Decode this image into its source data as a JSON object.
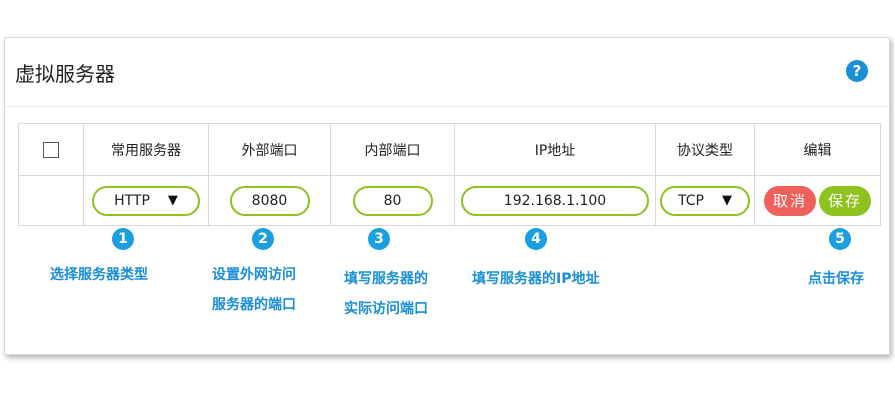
{
  "panel": {
    "title": "虚拟服务器"
  },
  "help_icon": "question-icon",
  "colors": {
    "accent_green": "#8dc21f",
    "cancel_red": "#f0615c",
    "callout_blue": "#1a9fe0",
    "help_blue": "#1a8ed6"
  },
  "table": {
    "headers": {
      "checkbox": "",
      "common_server": "常用服务器",
      "external_port": "外部端口",
      "internal_port": "内部端口",
      "ip_address": "IP地址",
      "protocol": "协议类型",
      "edit": "编辑"
    },
    "row": {
      "service": "HTTP",
      "external_port": "8080",
      "internal_port": "80",
      "ip_address": "192.168.1.100",
      "protocol": "TCP",
      "cancel_label": "取消",
      "save_label": "保存"
    }
  },
  "callouts": [
    {
      "num": "1",
      "lines": [
        "选择服务器类型"
      ]
    },
    {
      "num": "2",
      "lines": [
        "设置外网访问",
        "服务器的端口"
      ]
    },
    {
      "num": "3",
      "lines": [
        "填写服务器的",
        "实际访问端口"
      ]
    },
    {
      "num": "4",
      "lines": [
        "填写服务器的IP地址"
      ]
    },
    {
      "num": "5",
      "lines": [
        "点击保存"
      ]
    }
  ]
}
